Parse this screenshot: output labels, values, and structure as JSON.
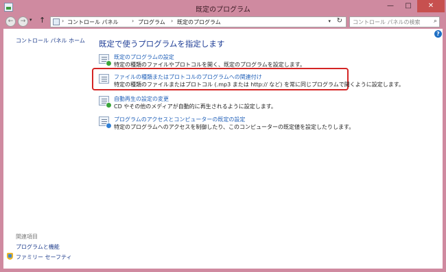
{
  "window": {
    "title": "既定のプログラム",
    "controls": {
      "minimize": "—",
      "maximize": "□",
      "close": "✕"
    }
  },
  "nav": {
    "back": "←",
    "forward": "→",
    "dropdown": "▾",
    "up": "↑",
    "breadcrumbs": [
      "コントロール パネル",
      "プログラム",
      "既定のプログラム"
    ],
    "crumb_sep": "›",
    "refresh": "↻",
    "search_placeholder": "コントロール パネルの検索",
    "search_glyph": "⌕"
  },
  "help_glyph": "?",
  "sidebar": {
    "home_link": "コントロール パネル ホーム",
    "related_heading": "関連項目",
    "related": [
      "プログラムと機能",
      "ファミリー セーフティ"
    ]
  },
  "main": {
    "title": "既定で使うプログラムを指定します",
    "items": [
      {
        "link": "既定のプログラムの設定",
        "desc": "特定の種類のファイルやプロトコルを開く、既定のプログラムを設定します。"
      },
      {
        "link": "ファイルの種類またはプロトコルのプログラムへの関連付け",
        "desc": "特定の種類のファイルまたはプロトコル (.mp3 または http:// など) を常に同じプログラムで開くように設定します。"
      },
      {
        "link": "自動再生の設定の変更",
        "desc": "CD やその他のメディアが自動的に再生されるように設定します。"
      },
      {
        "link": "プログラムのアクセスとコンピューターの既定の設定",
        "desc": "特定のプログラムへのアクセスを制御したり、このコンピューターの既定値を設定したりします。"
      }
    ]
  },
  "colors": {
    "frame": "#cf8aa0",
    "link": "#1f5fb8",
    "title": "#1e3d96",
    "highlight": "#d42424"
  }
}
